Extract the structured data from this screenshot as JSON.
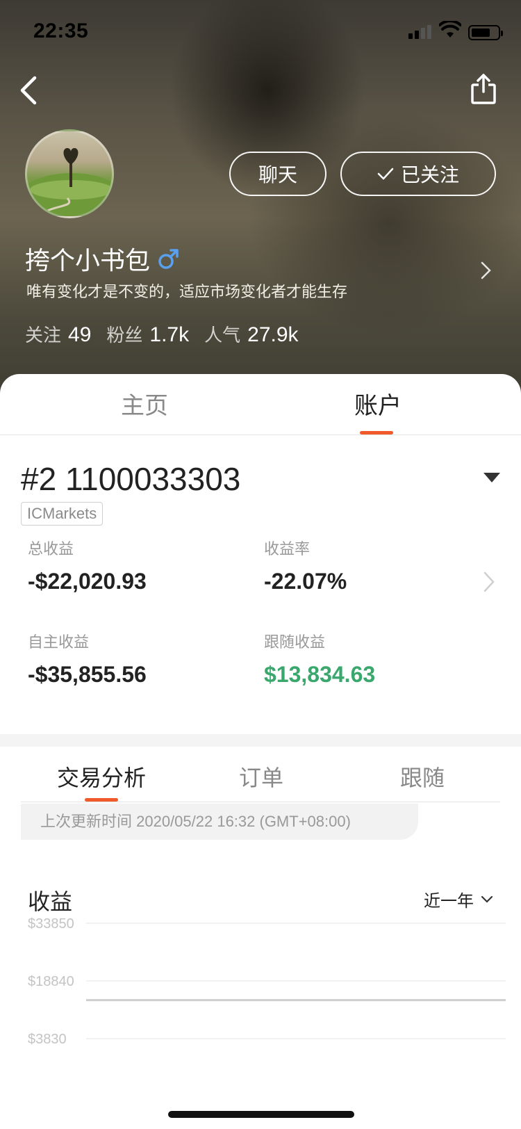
{
  "status_bar": {
    "time": "22:35"
  },
  "profile": {
    "name": "挎个小书包",
    "gender_symbol": "♂",
    "bio": "唯有变化才是不变的，适应市场变化者才能生存",
    "chat_label": "聊天",
    "follow_label": "已关注",
    "stats": [
      {
        "label": "关注",
        "value": "49"
      },
      {
        "label": "粉丝",
        "value": "1.7k"
      },
      {
        "label": "人气",
        "value": "27.9k"
      }
    ]
  },
  "main_tabs": {
    "home": "主页",
    "account": "账户"
  },
  "account": {
    "id": "#2 1100033303",
    "broker": "ICMarkets",
    "metrics": [
      {
        "label": "总收益",
        "value": "-$22,020.93"
      },
      {
        "label": "收益率",
        "value": "-22.07%"
      },
      {
        "label": "自主收益",
        "value": "-$35,855.56"
      },
      {
        "label": "跟随收益",
        "value": "$13,834.63"
      }
    ]
  },
  "sub_tabs": {
    "analysis": "交易分析",
    "orders": "订单",
    "follow": "跟随"
  },
  "update_note": "上次更新时间 2020/05/22 16:32 (GMT+08:00)",
  "chart_section": {
    "title": "收益",
    "range": "近一年"
  },
  "chart_data": {
    "type": "line",
    "title": "",
    "ylabel": "",
    "y_ticks": [
      "$33850",
      "$18840",
      "$3830"
    ],
    "y_tick_values": [
      33850,
      18840,
      3830
    ],
    "ylim": [
      3830,
      33850
    ],
    "series": [
      {
        "values": [
          13834.63,
          13834.63
        ]
      }
    ],
    "grid": true
  },
  "colors": {
    "accent": "#f05a2b",
    "positive": "#3aa76d"
  }
}
